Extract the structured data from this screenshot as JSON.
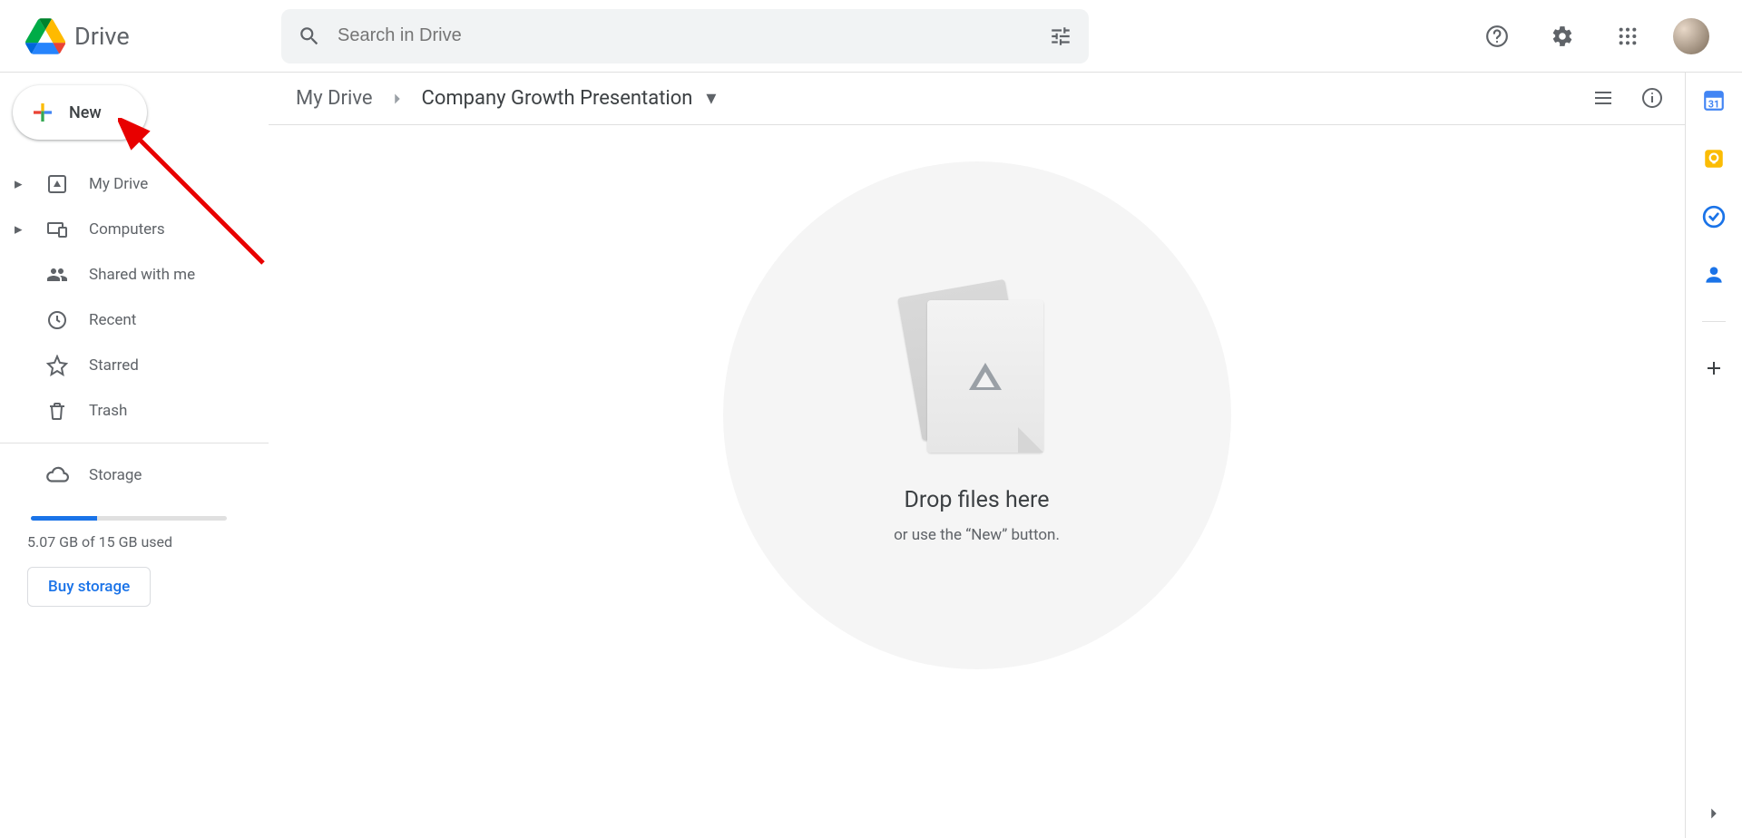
{
  "header": {
    "product_name": "Drive",
    "search_placeholder": "Search in Drive"
  },
  "sidebar": {
    "new_label": "New",
    "items": [
      {
        "label": "My Drive"
      },
      {
        "label": "Computers"
      },
      {
        "label": "Shared with me"
      },
      {
        "label": "Recent"
      },
      {
        "label": "Starred"
      },
      {
        "label": "Trash"
      }
    ],
    "storage_label": "Storage",
    "storage_text": "5.07 GB of 15 GB used",
    "storage_percent": 34,
    "buy_label": "Buy storage"
  },
  "breadcrumb": {
    "root": "My Drive",
    "current": "Company Growth Presentation"
  },
  "empty_state": {
    "title": "Drop files here",
    "subtitle": "or use the “New” button."
  }
}
